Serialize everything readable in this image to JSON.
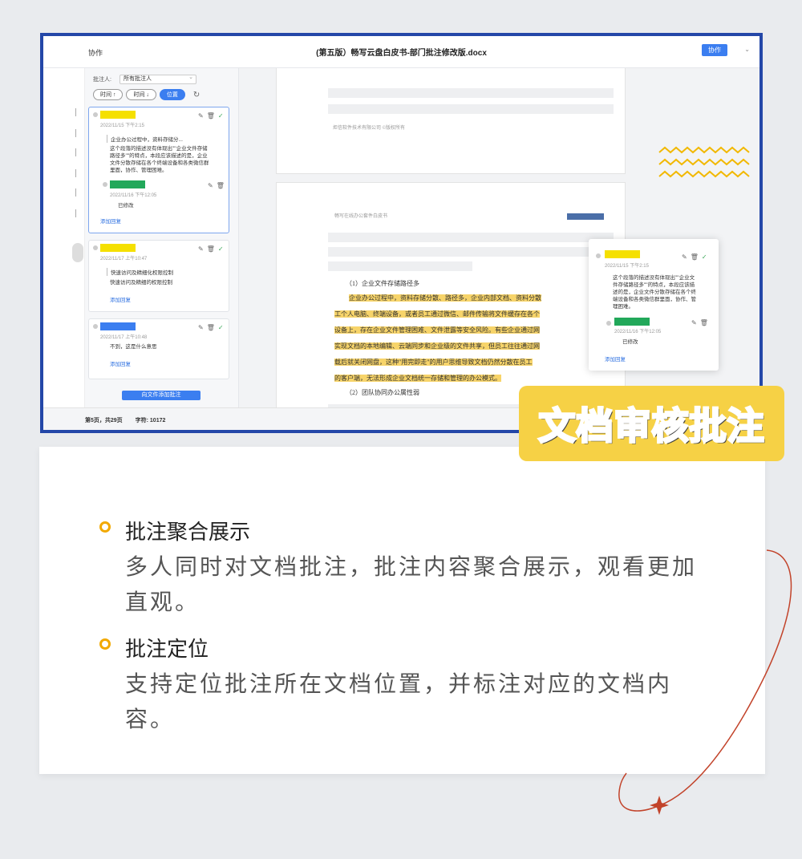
{
  "app": {
    "left_label": "协作",
    "doc_title": "(第五版）畅写云盘白皮书-部门批注修改版.docx",
    "collab_button": "协作",
    "caret": "⌄"
  },
  "comments_panel": {
    "filter_label": "批注人:",
    "filter_value": "所有批注人",
    "sort_time_asc": "时间 ↑",
    "sort_time_desc": "时间 ↓",
    "sort_position": "位置",
    "refresh_icon": "↻",
    "add_comment_button": "向文件添加批注",
    "cards": [
      {
        "author_color": "#f5e000",
        "time": "2022/11/15 下午2:15",
        "quote": "企业办公过程中，资料存储分...",
        "text_lines": [
          "这个段落的描述没有体现出\"\"企业文件存储",
          "路径多\"\"的特点，本段应该描述的是，企业",
          "文件分散存储在各个终端设备和各类微信群",
          "里面，协作、管理困难。"
        ],
        "reply_color": "#22a85a",
        "reply_time": "2022/11/16 下午12:05",
        "reply_text": "已修改",
        "add_reply": "添加回复"
      },
      {
        "author_color": "#f5e000",
        "time": "2022/11/17 上午10:47",
        "quote": "快速访问及精细化权限控制",
        "text_lines": [
          "快速访问及精细的权限控制"
        ],
        "add_reply": "添加回复"
      },
      {
        "author_color": "#3b7ef0",
        "time": "2022/11/17 上午10:48",
        "text_lines": [
          "不到，这是什么意思"
        ],
        "add_reply": "添加回复"
      }
    ]
  },
  "document": {
    "copyright": "炬信软件技术有限公司 ©版权所有",
    "header_text": "畅写在线办公套件白皮书",
    "section_heading": "（1）企业文件存储路径多",
    "para_lines": [
      "企业办公过程中，资料存储分散、路径多，企业内部文档、资料分散",
      "工个人电脑、终端设备，或者员工通过微信、邮件传输将文件缓存在各个",
      "设备上，存在企业文件管理困难、文件泄露等安全风险。有些企业通过网",
      "实现文档的本地编辑、云端同步和企业级的文件共享，但员工往往通过网",
      "载后就关闭网盘，这种\"用完即走\"的用户思维导致文档仍然分散在员工",
      "的客户端，无法形成企业文档统一存储和管理的办公模式。"
    ],
    "next_heading": "（2）团队协同办公属性弱"
  },
  "popup": {
    "author_color": "#f5e000",
    "time": "2022/11/15 下午2:15",
    "text_lines": [
      "这个段落的描述没有体现出\"\"企业文",
      "件存储路径多\"\"的特点，本段应该描",
      "述的是，企业文件分散存储在各个终",
      "端设备和各类微信群里面，协作、管",
      "理困难。"
    ],
    "reply_color": "#22a85a",
    "reply_time": "2022/11/16 下午12:05",
    "reply_text": "已修改",
    "add_reply": "添加回复"
  },
  "status_bar": {
    "page": "第5页，共29页",
    "chars": "字符: 10172"
  },
  "badge_text": "文档审核批注",
  "features": [
    {
      "title": "批注聚合展示",
      "desc": "多人同时对文档批注，批注内容聚合展示，观看更加直观。"
    },
    {
      "title": "批注定位",
      "desc": "支持定位批注所在文档位置，并标注对应的文档内容。"
    }
  ],
  "colors": {
    "frame_border": "#2447a8",
    "accent_blue": "#3b7ef0",
    "badge_yellow": "#f6d145",
    "highlight": "#f7d46a",
    "orbit_line": "#c2432a",
    "feature_ring": "#f2a900"
  }
}
